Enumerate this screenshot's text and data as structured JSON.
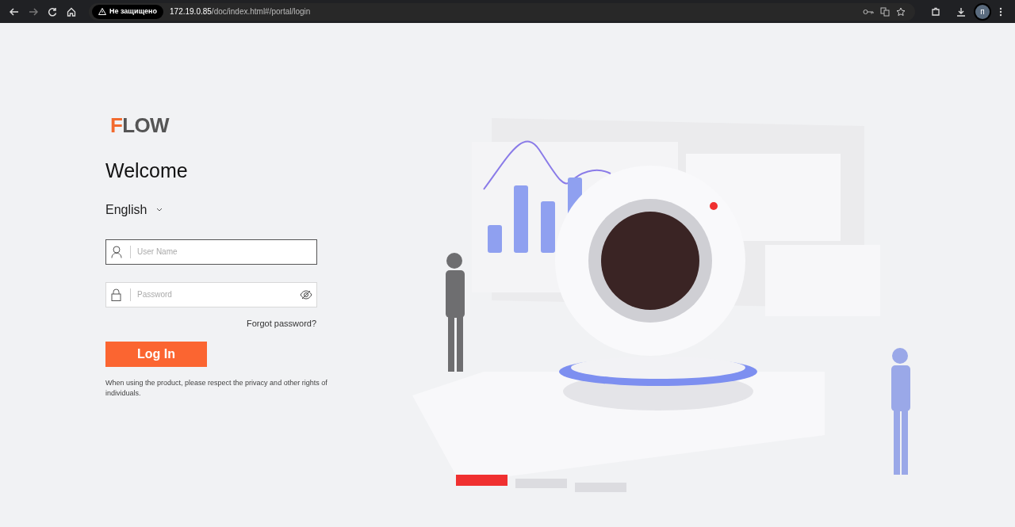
{
  "browser": {
    "security_label": "Не защищено",
    "url_host": "172.19.0.85",
    "url_path": "/doc/index.html#/portal/login",
    "profile_initial": "п"
  },
  "logo": {
    "accent": "F",
    "rest": "LOW"
  },
  "title": "Welcome",
  "language": {
    "value": "English"
  },
  "fields": [
    {
      "kind": "user",
      "placeholder": "User Name",
      "focused": true
    },
    {
      "kind": "password",
      "placeholder": "Password",
      "focused": false
    }
  ],
  "forgot_link": "Forgot password?",
  "login_button": "Log In",
  "notice": "When using the product, please respect the privacy and other rights of individuals."
}
